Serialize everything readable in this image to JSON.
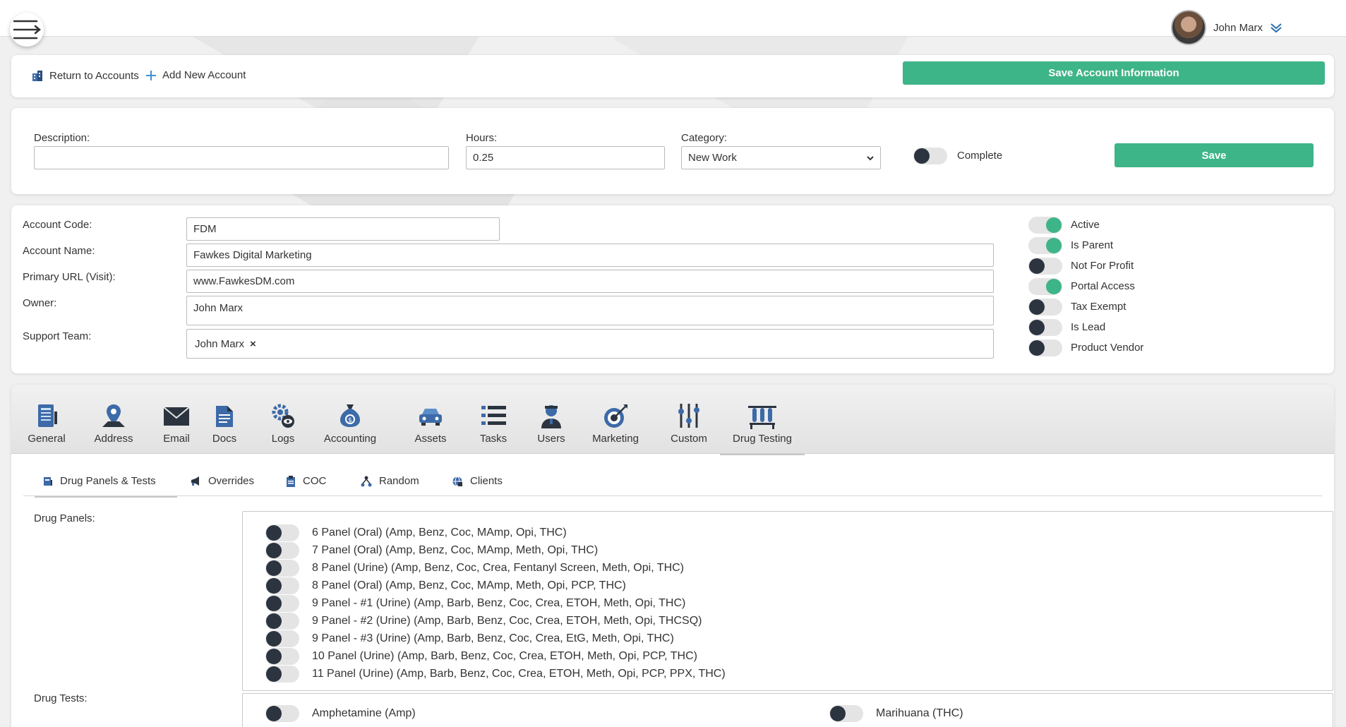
{
  "user": {
    "name": "John Marx"
  },
  "actions": {
    "return_label": "Return to Accounts",
    "add_label": "Add New Account",
    "save_account_label": "Save Account Information"
  },
  "task": {
    "description_label": "Description:",
    "description_value": "",
    "hours_label": "Hours:",
    "hours_value": "0.25",
    "category_label": "Category:",
    "category_value": "New Work",
    "complete_label": "Complete",
    "save_label": "Save"
  },
  "account": {
    "code_label": "Account Code:",
    "code_value": "FDM",
    "name_label": "Account Name:",
    "name_value": "Fawkes Digital Marketing",
    "url_label": "Primary URL (Visit):",
    "url_value": "www.FawkesDM.com",
    "owner_label": "Owner:",
    "owner_value": "John Marx",
    "support_label": "Support Team:",
    "support_chip": "John Marx",
    "support_remove": "×"
  },
  "flags": [
    {
      "label": "Active",
      "on": true
    },
    {
      "label": "Is Parent",
      "on": true
    },
    {
      "label": "Not For Profit",
      "on": false
    },
    {
      "label": "Portal Access",
      "on": true
    },
    {
      "label": "Tax Exempt",
      "on": false
    },
    {
      "label": "Is Lead",
      "on": false
    },
    {
      "label": "Product Vendor",
      "on": false
    }
  ],
  "icon_tabs": [
    {
      "label": "General",
      "icon": "notebook-icon"
    },
    {
      "label": "Address",
      "icon": "map-pin-icon"
    },
    {
      "label": "Email",
      "icon": "envelope-icon"
    },
    {
      "label": "Docs",
      "icon": "document-icon"
    },
    {
      "label": "Logs",
      "icon": "gear-eye-icon"
    },
    {
      "label": "Accounting",
      "icon": "money-bag-icon"
    },
    {
      "label": "Assets",
      "icon": "car-icon"
    },
    {
      "label": "Tasks",
      "icon": "list-icon"
    },
    {
      "label": "Users",
      "icon": "user-icon"
    },
    {
      "label": "Marketing",
      "icon": "target-icon"
    },
    {
      "label": "Custom",
      "icon": "sliders-icon"
    },
    {
      "label": "Drug Testing",
      "icon": "test-tubes-icon",
      "active": true
    }
  ],
  "sub_tabs": [
    {
      "label": "Drug Panels & Tests",
      "icon": "panel-icon",
      "active": true
    },
    {
      "label": "Overrides",
      "icon": "megaphone-icon"
    },
    {
      "label": "COC",
      "icon": "clipboard-icon"
    },
    {
      "label": "Random",
      "icon": "network-icon"
    },
    {
      "label": "Clients",
      "icon": "globe-icon"
    }
  ],
  "drug_panels_label": "Drug Panels:",
  "drug_panels": [
    "6 Panel (Oral) (Amp, Benz, Coc, MAmp, Opi, THC)",
    "7 Panel (Oral) (Amp, Benz, Coc, MAmp, Meth, Opi, THC)",
    "8 Panel (Urine) (Amp, Benz, Coc, Crea, Fentanyl Screen, Meth, Opi, THC)",
    "8 Panel (Oral) (Amp, Benz, Coc, MAmp, Meth, Opi, PCP, THC)",
    "9 Panel - #1 (Urine) (Amp, Barb, Benz, Coc, Crea, ETOH, Meth, Opi, THC)",
    "9 Panel - #2 (Urine) (Amp, Barb, Benz, Coc, Crea, ETOH, Meth, Opi, THCSQ)",
    "9 Panel - #3 (Urine) (Amp, Barb, Benz, Coc, Crea, EtG, Meth, Opi, THC)",
    "10 Panel (Urine) (Amp, Barb, Benz, Coc, Crea, ETOH, Meth, Opi, PCP, THC)",
    "11 Panel (Urine) (Amp, Barb, Benz, Coc, Crea, ETOH, Meth, Opi, PCP, PPX, THC)"
  ],
  "drug_tests_label": "Drug Tests:",
  "drug_tests_left": [
    "Amphetamine (Amp)"
  ],
  "drug_tests_right": [
    "Marihuana (THC)"
  ],
  "colors": {
    "accent": "#3eb489",
    "knob_off": "#2c3440"
  }
}
